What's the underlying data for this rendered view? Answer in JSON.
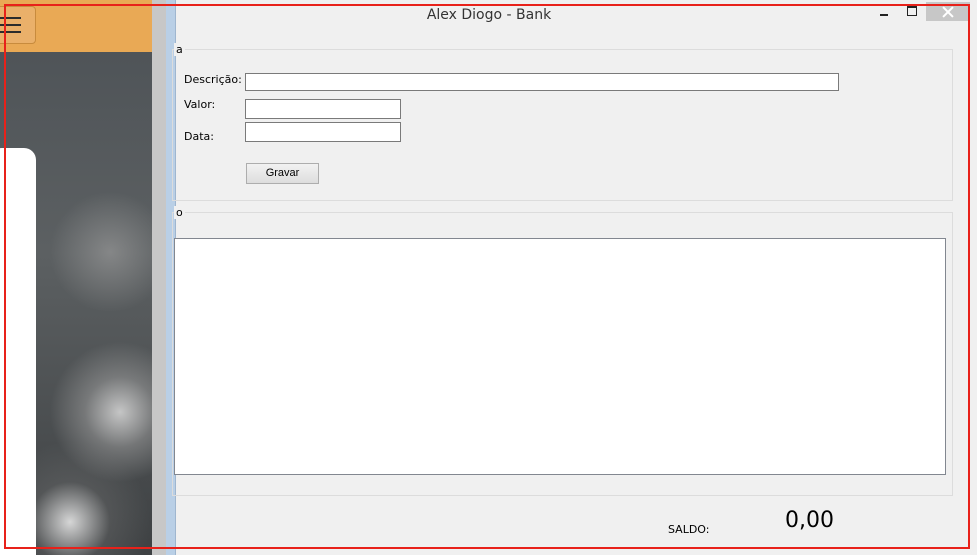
{
  "window": {
    "title": "Alex Diogo - Bank",
    "controls": {
      "minimize": "minimize",
      "maximize": "maximize",
      "close": "close"
    }
  },
  "form": {
    "group_label": "a",
    "descricao_label": "Descrição:",
    "descricao_value": "",
    "valor_label": "Valor:",
    "valor_value": "",
    "data_label": "Data:",
    "data_value": "",
    "gravar_label": "Gravar"
  },
  "list": {
    "group_label": "o",
    "items": []
  },
  "footer": {
    "saldo_label": "SALDO:",
    "saldo_value": "0,00"
  },
  "icons": [
    "hamburger-menu-icon",
    "minimize-icon",
    "maximize-icon",
    "close-icon"
  ],
  "colors": {
    "background_app_header": "#e9a955",
    "window_bg": "#f0f0f0",
    "close_button": "#c7c7c7",
    "highlight_frame": "#e8211a"
  }
}
